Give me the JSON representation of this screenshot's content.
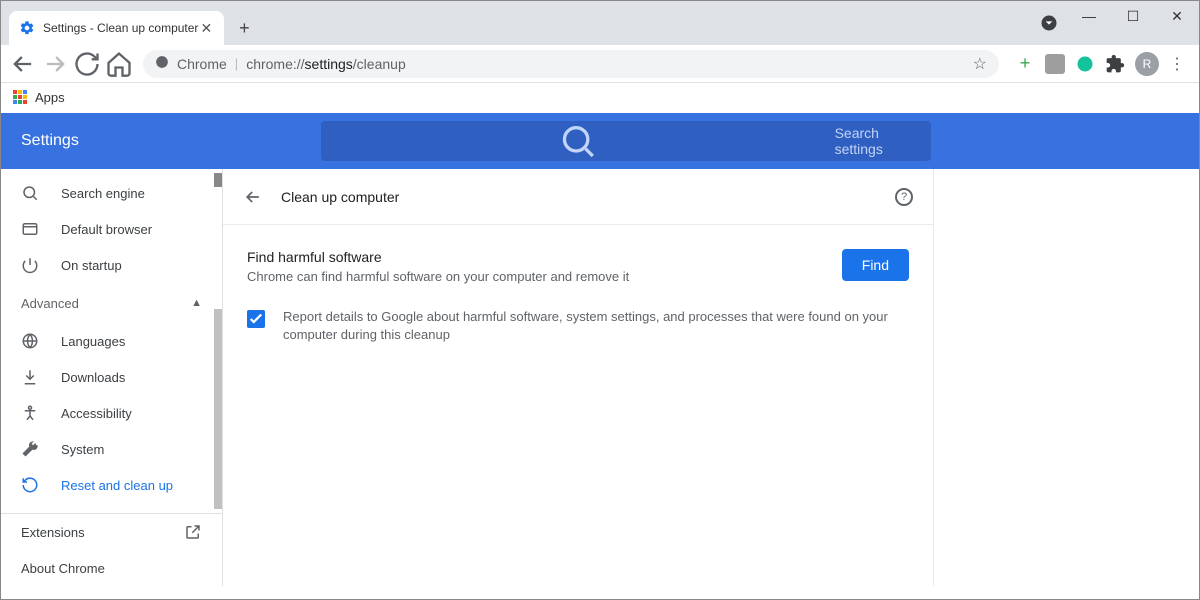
{
  "window": {
    "tab_title": "Settings - Clean up computer"
  },
  "omnibox": {
    "chrome_label": "Chrome",
    "url_prefix": "chrome://",
    "url_bold": "settings",
    "url_suffix": "/cleanup"
  },
  "bookmarks": {
    "apps_label": "Apps"
  },
  "header": {
    "title": "Settings",
    "search_placeholder": "Search settings"
  },
  "sidebar": {
    "items_top": [
      {
        "label": "Search engine"
      },
      {
        "label": "Default browser"
      },
      {
        "label": "On startup"
      }
    ],
    "section_label": "Advanced",
    "items_adv": [
      {
        "label": "Languages"
      },
      {
        "label": "Downloads"
      },
      {
        "label": "Accessibility"
      },
      {
        "label": "System"
      },
      {
        "label": "Reset and clean up"
      }
    ],
    "items_bottom": [
      {
        "label": "Extensions"
      },
      {
        "label": "About Chrome"
      }
    ]
  },
  "panel": {
    "title": "Clean up computer",
    "setting_title": "Find harmful software",
    "setting_sub": "Chrome can find harmful software on your computer and remove it",
    "find_button": "Find",
    "checkbox_text": "Report details to Google about harmful software, system settings, and processes that were found on your computer during this cleanup"
  },
  "avatar_initial": "R"
}
